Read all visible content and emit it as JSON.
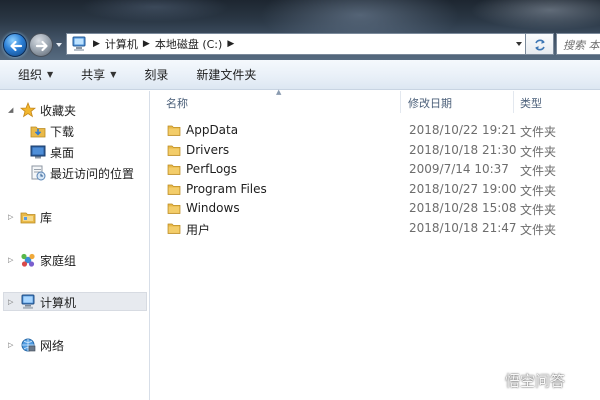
{
  "address": {
    "crumbs": [
      "计算机",
      "本地磁盘 (C:)"
    ],
    "search_placeholder": "搜索 本地磁盘 (C:)"
  },
  "toolbar": {
    "organize": "组织",
    "share": "共享",
    "burn": "刻录",
    "new_folder": "新建文件夹"
  },
  "navpane": {
    "favorites": "收藏夹",
    "favorites_items": [
      "下载",
      "桌面",
      "最近访问的位置"
    ],
    "libraries": "库",
    "homegroup": "家庭组",
    "computer": "计算机",
    "network": "网络"
  },
  "columns": {
    "name": "名称",
    "modified": "修改日期",
    "type": "类型"
  },
  "files": [
    {
      "name": "AppData",
      "modified": "2018/10/22 19:21",
      "type": "文件夹"
    },
    {
      "name": "Drivers",
      "modified": "2018/10/18 21:30",
      "type": "文件夹"
    },
    {
      "name": "PerfLogs",
      "modified": "2009/7/14 10:37",
      "type": "文件夹"
    },
    {
      "name": "Program Files",
      "modified": "2018/10/27 19:00",
      "type": "文件夹"
    },
    {
      "name": "Windows",
      "modified": "2018/10/28 15:08",
      "type": "文件夹"
    },
    {
      "name": "用户",
      "modified": "2018/10/18 21:47",
      "type": "文件夹"
    }
  ],
  "watermark": "悟空问答",
  "icons": {
    "back": "back-arrow-icon",
    "forward": "forward-arrow-icon",
    "refresh": "refresh-icon",
    "folder": "folder-icon",
    "star": "star-icon"
  },
  "colors": {
    "folder": "#e9b949",
    "header_text": "#4c607a",
    "secondary_text": "#6d6d6d",
    "selection": "#e7eaef"
  }
}
